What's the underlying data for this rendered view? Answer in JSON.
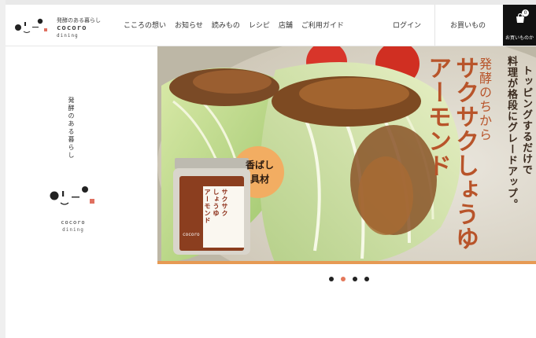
{
  "header": {
    "logo_tagline": "発酵のある暮らし",
    "logo_name": "cocoro",
    "logo_sub": "dining",
    "nav": [
      "こころの想い",
      "お知らせ",
      "読みもの",
      "レシピ",
      "店舗",
      "ご利用ガイド"
    ],
    "login": "ログイン",
    "shop": "お買いもの",
    "cart_label": "お買いものか",
    "cart_count": "0"
  },
  "sidebar": {
    "tagline": "発酵のある暮らし",
    "logo_name": "cocoro",
    "logo_sub": "dining"
  },
  "hero": {
    "subtitle": "発酵のちから",
    "title_line1": "サクサクしょうゆ",
    "title_line2": "アーモンド",
    "lead_line1": "トッピングするだけで",
    "lead_line2": "料理が格段にグレードアップ。",
    "badge_line1": "香ばし",
    "badge_line2": "具材",
    "jar_label_line1": "サクサク",
    "jar_label_line2": "しょうゆ",
    "jar_label_line3": "アーモンド",
    "jar_brand": "cocoro"
  },
  "carousel": {
    "slides": 4,
    "active_index": 1
  },
  "colors": {
    "accent": "#e69a54",
    "dot_active": "#e4785a",
    "cart_bg": "#111111"
  }
}
